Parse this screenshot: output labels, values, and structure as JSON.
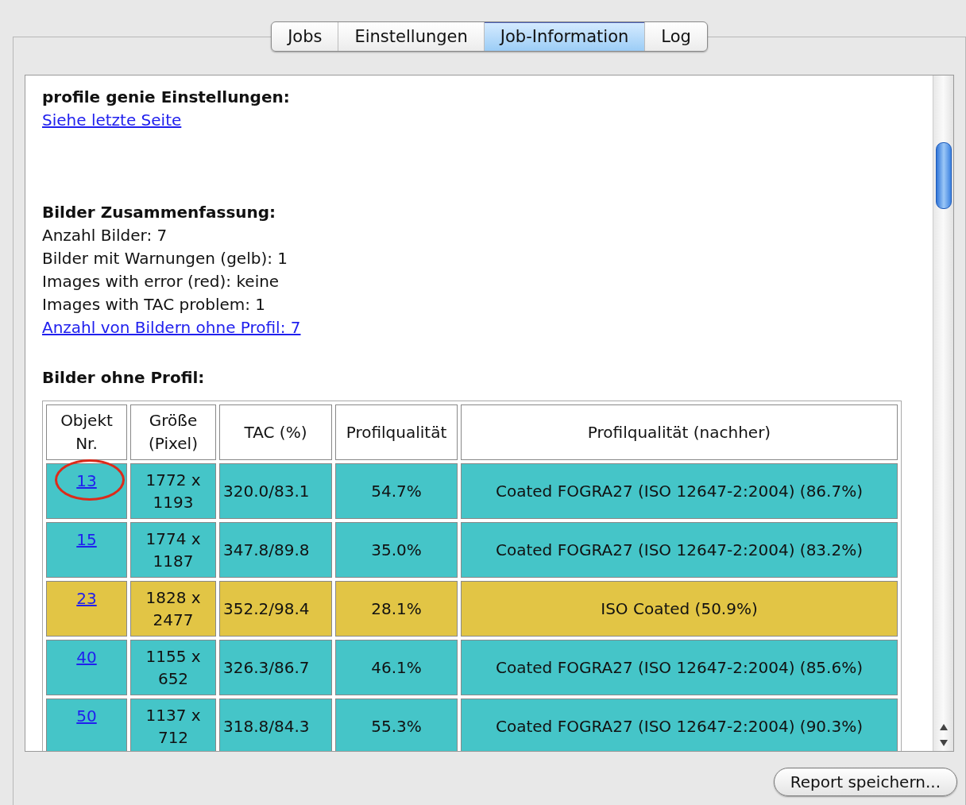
{
  "tabs": [
    {
      "label": "Jobs",
      "selected": false
    },
    {
      "label": "Einstellungen",
      "selected": false
    },
    {
      "label": "Job-Information",
      "selected": true
    },
    {
      "label": "Log",
      "selected": false
    }
  ],
  "sections": [
    {
      "heading": "profile genie Einstellungen:",
      "lines": [
        {
          "kind": "link",
          "text": "Siehe letzte Seite"
        }
      ]
    },
    {
      "heading": "Bilder Zusammenfassung:",
      "lines": [
        {
          "kind": "text",
          "text": "Anzahl Bilder: 7"
        },
        {
          "kind": "text",
          "text": "Bilder mit Warnungen (gelb): 1"
        },
        {
          "kind": "text",
          "text": "Images with error (red): keine"
        },
        {
          "kind": "text",
          "text": "Images with TAC problem: 1"
        },
        {
          "kind": "link",
          "text": "Anzahl von Bildern ohne Profil: 7"
        }
      ]
    },
    {
      "heading": "Bilder ohne Profil:"
    }
  ],
  "table": {
    "columns": [
      "Objekt Nr.",
      "Größe (Pixel)",
      "TAC (%)",
      "Profilqualität",
      "Profilqualität (nachher)"
    ],
    "rows": [
      {
        "object": "13",
        "size": "1772 x 1193",
        "tac": "320.0/83.1",
        "quality": "54.7%",
        "after": "Coated FOGRA27 (ISO 12647-2:2004) (86.7%)",
        "color": "#45c5c8",
        "circled": true
      },
      {
        "object": "15",
        "size": "1774 x 1187",
        "tac": "347.8/89.8",
        "quality": "35.0%",
        "after": "Coated FOGRA27 (ISO 12647-2:2004) (83.2%)",
        "color": "#45c5c8",
        "circled": false
      },
      {
        "object": "23",
        "size": "1828 x 2477",
        "tac": "352.2/98.4",
        "quality": "28.1%",
        "after": "ISO Coated (50.9%)",
        "color": "#e2c545",
        "circled": false
      },
      {
        "object": "40",
        "size": "1155 x 652",
        "tac": "326.3/86.7",
        "quality": "46.1%",
        "after": "Coated FOGRA27 (ISO 12647-2:2004) (85.6%)",
        "color": "#45c5c8",
        "circled": false
      },
      {
        "object": "50",
        "size": "1137 x 712",
        "tac": "318.8/84.3",
        "quality": "55.3%",
        "after": "Coated FOGRA27 (ISO 12647-2:2004) (90.3%)",
        "color": "#45c5c8",
        "circled": false
      }
    ]
  },
  "save_button": "Report speichern..."
}
